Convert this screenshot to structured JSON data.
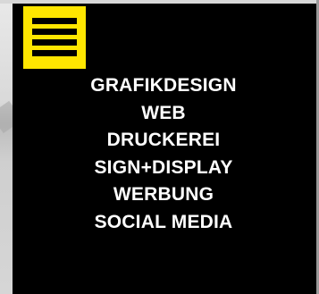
{
  "menu": {
    "toggle_icon": "hamburger-menu-icon",
    "accent_color": "#ffe600",
    "background_color": "#000000",
    "items": [
      {
        "label": "GRAFIKDESIGN"
      },
      {
        "label": "WEB"
      },
      {
        "label": "DRUCKEREI"
      },
      {
        "label": "SIGN+DISPLAY"
      },
      {
        "label": "WERBUNG"
      },
      {
        "label": "SOCIAL MEDIA"
      }
    ]
  }
}
